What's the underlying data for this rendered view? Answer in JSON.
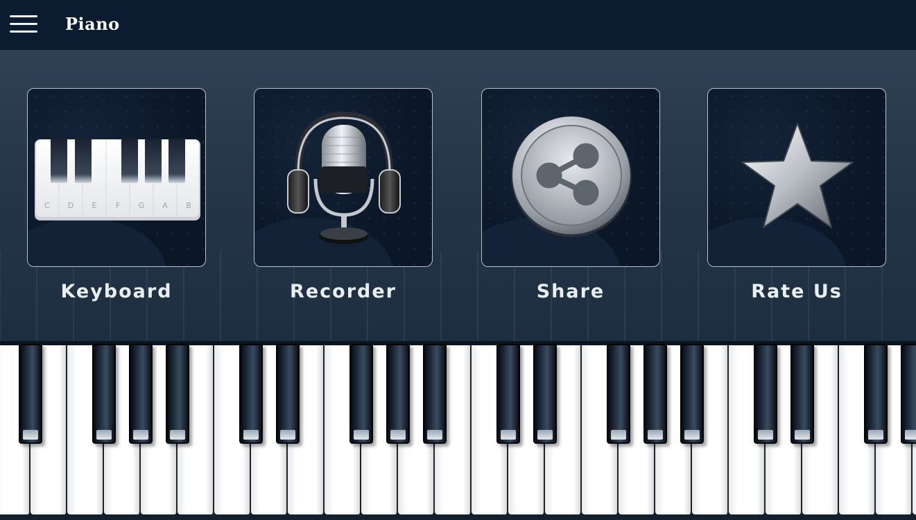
{
  "header": {
    "title": "Piano",
    "menu_icon": "hamburger-menu-icon"
  },
  "tiles": [
    {
      "label": "Keyboard",
      "icon": "piano-keyboard-icon",
      "keyboard_notes": [
        "C",
        "D",
        "E",
        "F",
        "G",
        "A",
        "B"
      ]
    },
    {
      "label": "Recorder",
      "icon": "microphone-headphones-icon"
    },
    {
      "label": "Share",
      "icon": "share-icon"
    },
    {
      "label": "Rate Us",
      "icon": "star-icon"
    }
  ],
  "colors": {
    "header_bg": "#0b1b30",
    "panel_bg": "#2f4154",
    "tile_border": "#b9c3ce",
    "label_text": "#e9eef3"
  },
  "piano": {
    "white_key_count": 26
  }
}
